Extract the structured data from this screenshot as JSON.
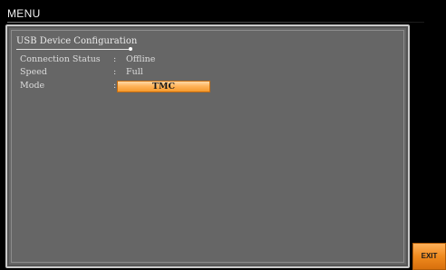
{
  "header": {
    "title": "MENU"
  },
  "panel": {
    "title": "USB Device Configuration",
    "fields": [
      {
        "label": "Connection Status",
        "separator": ":",
        "value": "Offline"
      },
      {
        "label": "Speed",
        "separator": ":",
        "value": "Full"
      },
      {
        "label": "Mode",
        "separator": ":",
        "value": "TMC"
      }
    ]
  },
  "softkeys": {
    "exit_label": "EXIT"
  },
  "colors": {
    "accent": "#f59a2c",
    "panel_background": "#666666",
    "panel_border": "#c9c9c9",
    "screen_background": "#000000"
  }
}
